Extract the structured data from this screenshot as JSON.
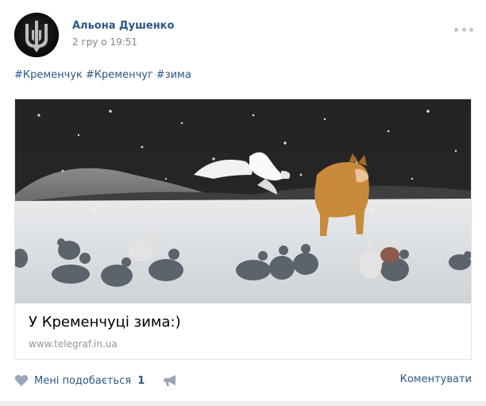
{
  "post": {
    "author": "Альона Душенко",
    "date": "2 гру о 19:51",
    "hashtags": [
      "#Кременчук",
      "#Кременчуг",
      "#зима"
    ]
  },
  "attachment": {
    "title": "У Кременчуці зима:)",
    "domain": "www.telegraf.in.ua"
  },
  "actions": {
    "like_label": "Мені подобається",
    "like_count": "1",
    "comment_label": "Коментувати"
  },
  "colors": {
    "link": "#2a5885",
    "muted": "#828282",
    "icon": "#bec5cc",
    "border": "#e1e3e6"
  },
  "icons": [
    "avatar-trident",
    "more-dots-icon",
    "heart-icon",
    "megaphone-icon"
  ]
}
